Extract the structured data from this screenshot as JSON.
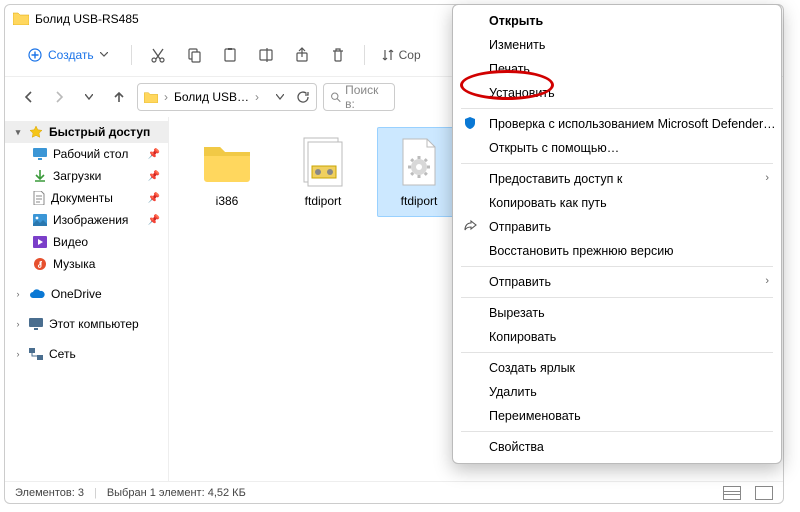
{
  "titlebar": {
    "title": "Болид USB-RS485"
  },
  "toolbar": {
    "create_label": "Создать",
    "sort_label_trunc": "Сор"
  },
  "addressbar": {
    "folder_trunc": "Болид USB…",
    "chevron": "›"
  },
  "search": {
    "placeholder_trunc": "Поиск в:"
  },
  "sidebar": {
    "quick": "Быстрый доступ",
    "items": [
      {
        "label": "Рабочий стол",
        "pinned": true
      },
      {
        "label": "Загрузки",
        "pinned": true
      },
      {
        "label": "Документы",
        "pinned": true
      },
      {
        "label": "Изображения",
        "pinned": true
      },
      {
        "label": "Видео"
      },
      {
        "label": "Музыка"
      }
    ],
    "onedrive": "OneDrive",
    "thispc": "Этот компьютер",
    "network": "Сеть"
  },
  "files": [
    {
      "name": "i386",
      "type": "folder"
    },
    {
      "name": "ftdiport",
      "type": "inf-cat"
    },
    {
      "name": "ftdiport",
      "type": "inf",
      "selected": true
    }
  ],
  "statusbar": {
    "count": "Элементов: 3",
    "selected": "Выбран 1 элемент: 4,52 КБ"
  },
  "contextmenu": {
    "open": "Открыть",
    "edit": "Изменить",
    "print": "Печать",
    "install": "Установить",
    "defender": "Проверка с использованием Microsoft Defender…",
    "openwith": "Открыть с помощью…",
    "grantaccess": "Предоставить доступ к",
    "copypath": "Копировать как путь",
    "share": "Отправить",
    "restorever": "Восстановить прежнюю версию",
    "sendto": "Отправить",
    "cut": "Вырезать",
    "copy": "Копировать",
    "shortcut": "Создать ярлык",
    "delete": "Удалить",
    "rename": "Переименовать",
    "properties": "Свойства"
  }
}
